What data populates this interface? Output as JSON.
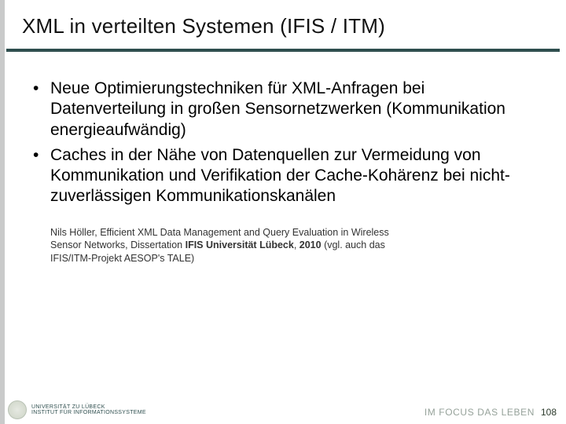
{
  "title": "XML in verteilten Systemen (IFIS / ITM)",
  "bullets": [
    "Neue Optimierungstechniken für XML-Anfragen bei Datenverteilung in großen Sensornetzwerken (Kommunikation energieaufwändig)",
    "Caches in der Nähe von Datenquellen zur Vermeidung von Kommunikation und Verifikation der Cache-Kohärenz bei nicht-zuverlässigen Kommunikationskanälen"
  ],
  "citation": {
    "text_pre": "Nils Höller, Efficient XML Data Management and Query Evaluation in Wireless Sensor Networks, Dissertation ",
    "bold1": "IFIS Universität Lübeck",
    "mid": ", ",
    "bold2": "2010",
    "text_post": " (vgl. auch das IFIS/ITM-Projekt AESOP's TALE)"
  },
  "footer": {
    "logo_line1": "UNIVERSITÄT ZU LÜBECK",
    "logo_line2": "INSTITUT FÜR INFORMATIONSSYSTEME",
    "tagline": "IM FOCUS DAS LEBEN",
    "page": "108"
  }
}
